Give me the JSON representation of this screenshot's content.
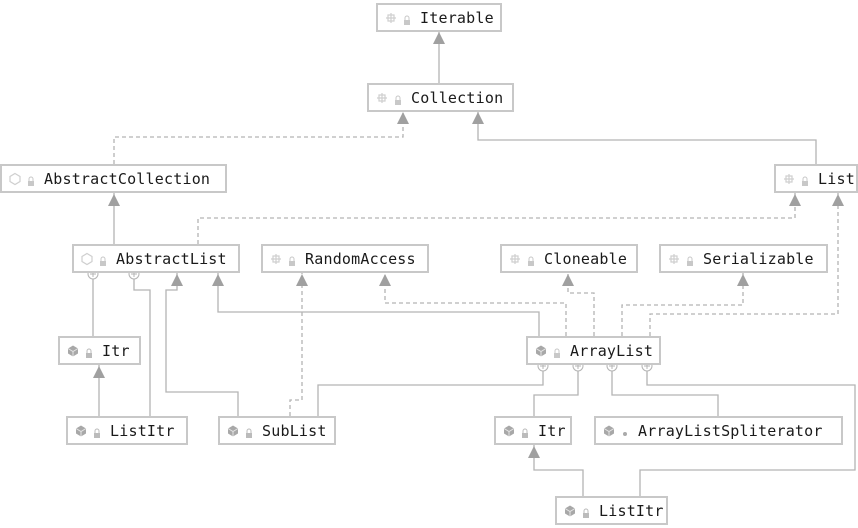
{
  "diagram": {
    "nodes": [
      {
        "id": "iterable",
        "name": "Iterable",
        "kind": "interface",
        "visibility": "public"
      },
      {
        "id": "collection",
        "name": "Collection",
        "kind": "interface",
        "visibility": "public"
      },
      {
        "id": "abstractcollection",
        "name": "AbstractCollection",
        "kind": "abstract-class",
        "visibility": "public"
      },
      {
        "id": "list",
        "name": "List",
        "kind": "interface",
        "visibility": "public"
      },
      {
        "id": "abstractlist",
        "name": "AbstractList",
        "kind": "abstract-class",
        "visibility": "public"
      },
      {
        "id": "randomaccess",
        "name": "RandomAccess",
        "kind": "interface",
        "visibility": "public"
      },
      {
        "id": "cloneable",
        "name": "Cloneable",
        "kind": "interface",
        "visibility": "public"
      },
      {
        "id": "serializable",
        "name": "Serializable",
        "kind": "interface",
        "visibility": "public"
      },
      {
        "id": "itr1",
        "name": "Itr",
        "kind": "class",
        "visibility": "private"
      },
      {
        "id": "arraylist",
        "name": "ArrayList",
        "kind": "class",
        "visibility": "public"
      },
      {
        "id": "listitr1",
        "name": "ListItr",
        "kind": "class",
        "visibility": "private"
      },
      {
        "id": "sublist",
        "name": "SubList",
        "kind": "class",
        "visibility": "private"
      },
      {
        "id": "itr2",
        "name": "Itr",
        "kind": "class",
        "visibility": "private"
      },
      {
        "id": "spliterator",
        "name": "ArrayListSpliterator",
        "kind": "class",
        "visibility": "package"
      },
      {
        "id": "listitr2",
        "name": "ListItr",
        "kind": "class",
        "visibility": "private"
      }
    ],
    "edges": [
      {
        "from": "collection",
        "to": "iterable",
        "type": "extends"
      },
      {
        "from": "abstractcollection",
        "to": "collection",
        "type": "implements"
      },
      {
        "from": "list",
        "to": "collection",
        "type": "extends"
      },
      {
        "from": "abstractlist",
        "to": "abstractcollection",
        "type": "extends"
      },
      {
        "from": "abstractlist",
        "to": "list",
        "type": "implements"
      },
      {
        "from": "arraylist",
        "to": "abstractlist",
        "type": "extends"
      },
      {
        "from": "arraylist",
        "to": "randomaccess",
        "type": "implements"
      },
      {
        "from": "arraylist",
        "to": "cloneable",
        "type": "implements"
      },
      {
        "from": "arraylist",
        "to": "serializable",
        "type": "implements"
      },
      {
        "from": "arraylist",
        "to": "list",
        "type": "implements"
      },
      {
        "from": "itr1",
        "to": "abstractlist",
        "type": "inner"
      },
      {
        "from": "listitr1",
        "to": "abstractlist",
        "type": "inner"
      },
      {
        "from": "listitr1",
        "to": "itr1",
        "type": "extends"
      },
      {
        "from": "sublist",
        "to": "abstractlist",
        "type": "extends"
      },
      {
        "from": "sublist",
        "to": "randomaccess",
        "type": "implements"
      },
      {
        "from": "sublist",
        "to": "arraylist",
        "type": "inner"
      },
      {
        "from": "itr2",
        "to": "arraylist",
        "type": "inner"
      },
      {
        "from": "spliterator",
        "to": "arraylist",
        "type": "inner"
      },
      {
        "from": "listitr2",
        "to": "arraylist",
        "type": "inner"
      },
      {
        "from": "listitr2",
        "to": "itr2",
        "type": "extends"
      }
    ],
    "colors": {
      "line": "#b4b4b4",
      "arrow": "#a0a0a0",
      "border": "#c8c8c8",
      "class_icon": "#a8a8a8"
    }
  }
}
